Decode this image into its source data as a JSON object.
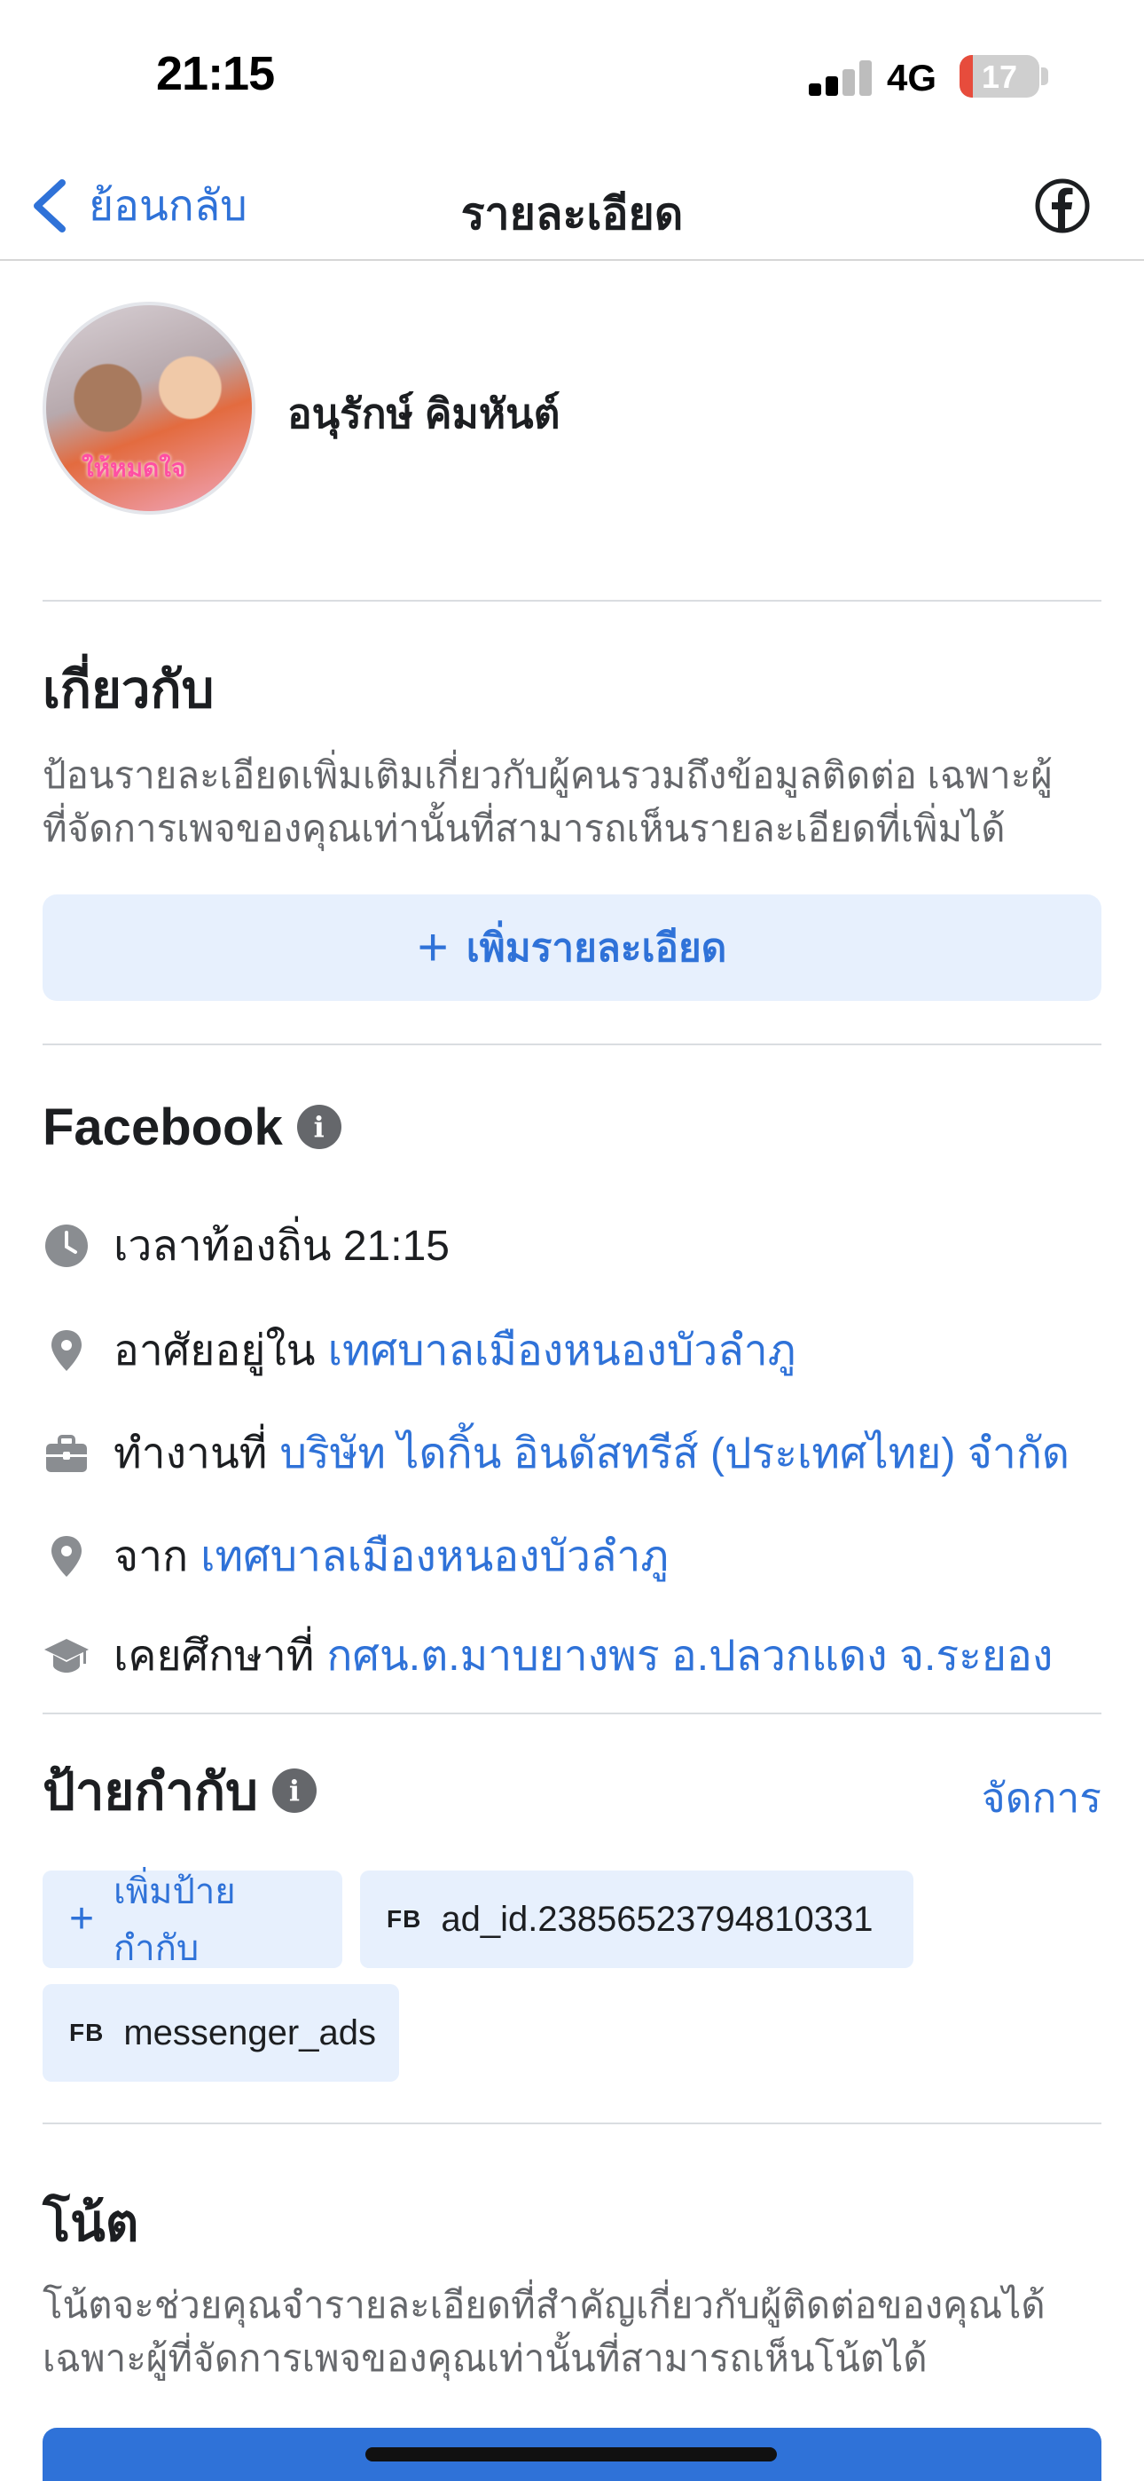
{
  "status_bar": {
    "time": "21:15",
    "network": "4G",
    "battery": "17",
    "battery_level": 0.17,
    "battery_color": "#e74c3c"
  },
  "nav": {
    "back_label": "ย้อนกลับ",
    "title": "รายละเอียด",
    "back_icon": "chevron-left-icon",
    "right_icon": "facebook-icon"
  },
  "profile": {
    "name": "อนุรักษ์ คิมหันต์",
    "avatar_caption": "ให้หมดใจ"
  },
  "about": {
    "title": "เกี่ยวกับ",
    "description_line1": "ป้อนรายละเอียดเพิ่มเติมเกี่ยวกับผู้คนรวมถึงข้อมูลติดต่อ เฉพาะผู้",
    "description_line2": "ที่จัดการเพจของคุณเท่านั้นที่สามารถเห็นรายละเอียดที่เพิ่มได้",
    "add_button": "เพิ่มรายละเอียด"
  },
  "facebook_section": {
    "title": "Facebook",
    "local_time": {
      "label": "เวลาท้องถิ่น 21:15",
      "icon": "clock-icon"
    },
    "lives_in": {
      "label": "อาศัยอยู่ใน",
      "value": "เทศบาลเมืองหนองบัวลำภู",
      "icon": "location-pin-icon"
    },
    "works_at": {
      "label": "ทำงานที่",
      "value": "บริษัท ไดกิ้น อินดัสทรีส์ (ประเทศไทย) จำกัด",
      "icon": "briefcase-icon"
    },
    "from": {
      "label": "จาก",
      "value": "เทศบาลเมืองหนองบัวลำภู",
      "icon": "location-pin-icon"
    },
    "studied_at": {
      "label": "เคยศึกษาที่",
      "value": "กศน.ต.มาบยางพร อ.ปลวกแดง จ.ระยอง",
      "icon": "graduation-cap-icon"
    }
  },
  "tags": {
    "title": "ป้ายกำกับ",
    "manage": "จัดการ",
    "add_tag": "เพิ่มป้ายกำกับ",
    "fb_badge": "FB",
    "items": [
      "ad_id.23856523794810331",
      "messenger_ads"
    ]
  },
  "notes": {
    "title": "โน้ต",
    "description_line1": "โน้ตจะช่วยคุณจำรายละเอียดที่สำคัญเกี่ยวกับผู้ติดต่อของคุณได้",
    "description_line2": "เฉพาะผู้ที่จัดการเพจของคุณเท่านั้นที่สามารถเห็นโน้ตได้"
  },
  "colors": {
    "accent": "#2f72d8",
    "chip_bg": "#e7f0fd",
    "muted_text": "#65676b"
  }
}
